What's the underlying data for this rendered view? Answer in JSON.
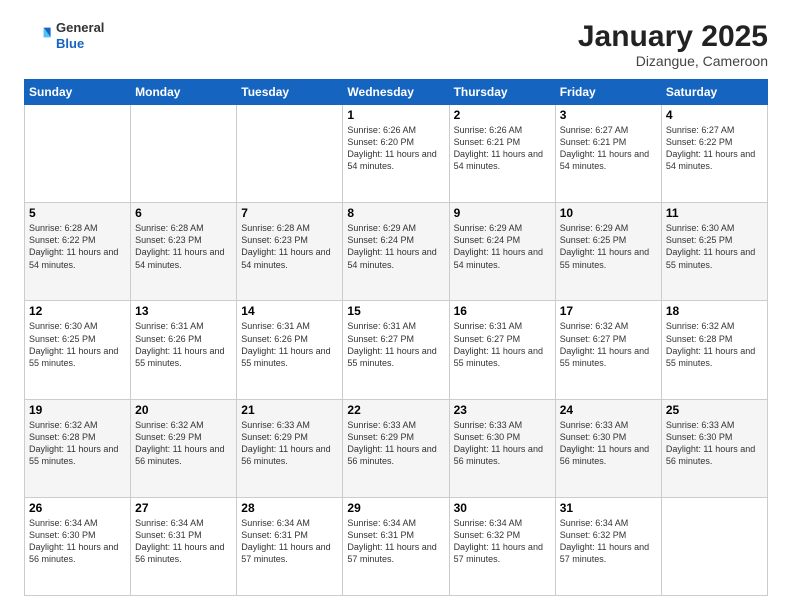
{
  "header": {
    "logo_general": "General",
    "logo_blue": "Blue",
    "month": "January 2025",
    "location": "Dizangue, Cameroon"
  },
  "weekdays": [
    "Sunday",
    "Monday",
    "Tuesday",
    "Wednesday",
    "Thursday",
    "Friday",
    "Saturday"
  ],
  "weeks": [
    [
      {
        "day": "",
        "info": ""
      },
      {
        "day": "",
        "info": ""
      },
      {
        "day": "",
        "info": ""
      },
      {
        "day": "1",
        "info": "Sunrise: 6:26 AM\nSunset: 6:20 PM\nDaylight: 11 hours\nand 54 minutes."
      },
      {
        "day": "2",
        "info": "Sunrise: 6:26 AM\nSunset: 6:21 PM\nDaylight: 11 hours\nand 54 minutes."
      },
      {
        "day": "3",
        "info": "Sunrise: 6:27 AM\nSunset: 6:21 PM\nDaylight: 11 hours\nand 54 minutes."
      },
      {
        "day": "4",
        "info": "Sunrise: 6:27 AM\nSunset: 6:22 PM\nDaylight: 11 hours\nand 54 minutes."
      }
    ],
    [
      {
        "day": "5",
        "info": "Sunrise: 6:28 AM\nSunset: 6:22 PM\nDaylight: 11 hours\nand 54 minutes."
      },
      {
        "day": "6",
        "info": "Sunrise: 6:28 AM\nSunset: 6:23 PM\nDaylight: 11 hours\nand 54 minutes."
      },
      {
        "day": "7",
        "info": "Sunrise: 6:28 AM\nSunset: 6:23 PM\nDaylight: 11 hours\nand 54 minutes."
      },
      {
        "day": "8",
        "info": "Sunrise: 6:29 AM\nSunset: 6:24 PM\nDaylight: 11 hours\nand 54 minutes."
      },
      {
        "day": "9",
        "info": "Sunrise: 6:29 AM\nSunset: 6:24 PM\nDaylight: 11 hours\nand 54 minutes."
      },
      {
        "day": "10",
        "info": "Sunrise: 6:29 AM\nSunset: 6:25 PM\nDaylight: 11 hours\nand 55 minutes."
      },
      {
        "day": "11",
        "info": "Sunrise: 6:30 AM\nSunset: 6:25 PM\nDaylight: 11 hours\nand 55 minutes."
      }
    ],
    [
      {
        "day": "12",
        "info": "Sunrise: 6:30 AM\nSunset: 6:25 PM\nDaylight: 11 hours\nand 55 minutes."
      },
      {
        "day": "13",
        "info": "Sunrise: 6:31 AM\nSunset: 6:26 PM\nDaylight: 11 hours\nand 55 minutes."
      },
      {
        "day": "14",
        "info": "Sunrise: 6:31 AM\nSunset: 6:26 PM\nDaylight: 11 hours\nand 55 minutes."
      },
      {
        "day": "15",
        "info": "Sunrise: 6:31 AM\nSunset: 6:27 PM\nDaylight: 11 hours\nand 55 minutes."
      },
      {
        "day": "16",
        "info": "Sunrise: 6:31 AM\nSunset: 6:27 PM\nDaylight: 11 hours\nand 55 minutes."
      },
      {
        "day": "17",
        "info": "Sunrise: 6:32 AM\nSunset: 6:27 PM\nDaylight: 11 hours\nand 55 minutes."
      },
      {
        "day": "18",
        "info": "Sunrise: 6:32 AM\nSunset: 6:28 PM\nDaylight: 11 hours\nand 55 minutes."
      }
    ],
    [
      {
        "day": "19",
        "info": "Sunrise: 6:32 AM\nSunset: 6:28 PM\nDaylight: 11 hours\nand 55 minutes."
      },
      {
        "day": "20",
        "info": "Sunrise: 6:32 AM\nSunset: 6:29 PM\nDaylight: 11 hours\nand 56 minutes."
      },
      {
        "day": "21",
        "info": "Sunrise: 6:33 AM\nSunset: 6:29 PM\nDaylight: 11 hours\nand 56 minutes."
      },
      {
        "day": "22",
        "info": "Sunrise: 6:33 AM\nSunset: 6:29 PM\nDaylight: 11 hours\nand 56 minutes."
      },
      {
        "day": "23",
        "info": "Sunrise: 6:33 AM\nSunset: 6:30 PM\nDaylight: 11 hours\nand 56 minutes."
      },
      {
        "day": "24",
        "info": "Sunrise: 6:33 AM\nSunset: 6:30 PM\nDaylight: 11 hours\nand 56 minutes."
      },
      {
        "day": "25",
        "info": "Sunrise: 6:33 AM\nSunset: 6:30 PM\nDaylight: 11 hours\nand 56 minutes."
      }
    ],
    [
      {
        "day": "26",
        "info": "Sunrise: 6:34 AM\nSunset: 6:30 PM\nDaylight: 11 hours\nand 56 minutes."
      },
      {
        "day": "27",
        "info": "Sunrise: 6:34 AM\nSunset: 6:31 PM\nDaylight: 11 hours\nand 56 minutes."
      },
      {
        "day": "28",
        "info": "Sunrise: 6:34 AM\nSunset: 6:31 PM\nDaylight: 11 hours\nand 57 minutes."
      },
      {
        "day": "29",
        "info": "Sunrise: 6:34 AM\nSunset: 6:31 PM\nDaylight: 11 hours\nand 57 minutes."
      },
      {
        "day": "30",
        "info": "Sunrise: 6:34 AM\nSunset: 6:32 PM\nDaylight: 11 hours\nand 57 minutes."
      },
      {
        "day": "31",
        "info": "Sunrise: 6:34 AM\nSunset: 6:32 PM\nDaylight: 11 hours\nand 57 minutes."
      },
      {
        "day": "",
        "info": ""
      }
    ]
  ]
}
